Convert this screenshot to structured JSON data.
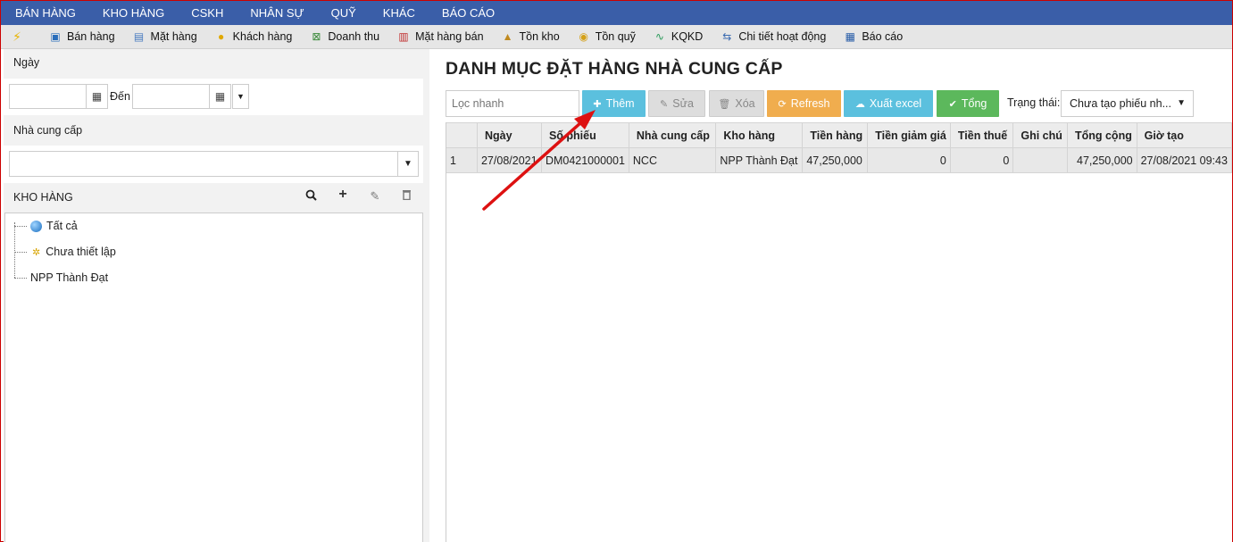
{
  "topnav": [
    "Bán hàng",
    "Kho hàng",
    "CSKH",
    "Nhân sự",
    "Quỹ",
    "Khác",
    "Báo cáo"
  ],
  "toolbar": [
    {
      "label": "Bán hàng",
      "icon": "cashier-icon"
    },
    {
      "label": "Mặt hàng",
      "icon": "product-icon"
    },
    {
      "label": "Khách hàng",
      "icon": "customer-icon"
    },
    {
      "label": "Doanh thu",
      "icon": "revenue-icon"
    },
    {
      "label": "Mặt hàng bán",
      "icon": "chart-icon"
    },
    {
      "label": "Tồn kho",
      "icon": "stock-icon"
    },
    {
      "label": "Tồn quỹ",
      "icon": "coins-icon"
    },
    {
      "label": "KQKD",
      "icon": "pulse-icon"
    },
    {
      "label": "Chi tiết hoạt động",
      "icon": "activity-icon"
    },
    {
      "label": "Báo cáo",
      "icon": "report-icon"
    }
  ],
  "left": {
    "date_label": "Ngày",
    "to_label": "Đến",
    "supplier_label": "Nhà cung cấp",
    "warehouse_title": "Kho hàng",
    "tree": [
      "Tất cả",
      "Chưa thiết lập",
      "NPP Thành Đạt"
    ]
  },
  "main": {
    "title": "Danh mục đặt hàng nhà cung cấp",
    "filter_placeholder": "Lọc nhanh",
    "buttons": {
      "add": "Thêm",
      "edit": "Sửa",
      "delete": "Xóa",
      "refresh": "Refresh",
      "excel": "Xuất excel",
      "total": "Tổng"
    },
    "status_label": "Trạng thái:",
    "status_value": "Chưa tạo phiếu nh..."
  },
  "table": {
    "columns": [
      "",
      "Ngày",
      "Số phiếu",
      "Nhà cung cấp",
      "Kho hàng",
      "Tiền hàng",
      "Tiền giảm giá",
      "Tiền thuế",
      "Ghi chú",
      "Tổng cộng",
      "Giờ tạo"
    ],
    "rows": [
      [
        "1",
        "27/08/2021",
        "DM0421000001",
        "NCC",
        "NPP Thành Đạt",
        "47,250,000",
        "0",
        "0",
        "",
        "47,250,000",
        "27/08/2021 09:43"
      ]
    ]
  },
  "colors": {
    "nav": "#3a5ea8",
    "add": "#5bc0de",
    "refresh": "#f0ad4e",
    "total": "#5cb85c",
    "annotation_arrow": "#dd1111"
  }
}
